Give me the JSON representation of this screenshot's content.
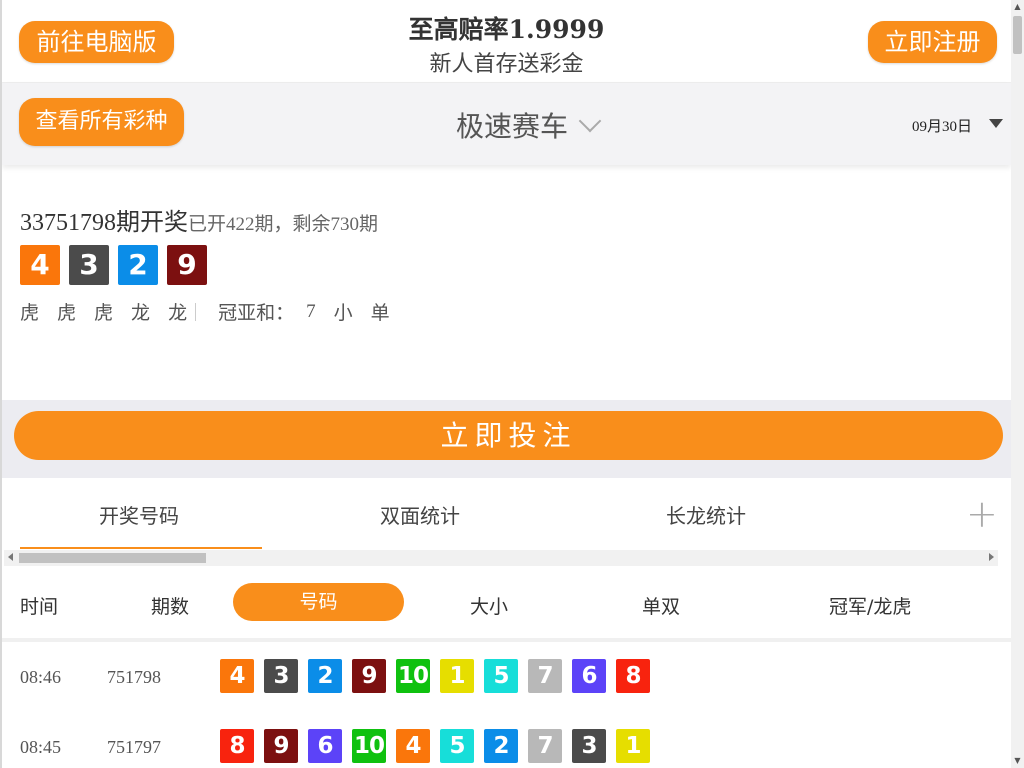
{
  "header": {
    "pc_button": "前往电脑版",
    "title": "至高赔率1.9999",
    "subtitle": "新人首存送彩金",
    "register_button": "立即注册"
  },
  "selector": {
    "all_games_button": "查看所有彩种",
    "game_name": "极速赛车",
    "date": "09月30日"
  },
  "latest": {
    "issue": "33751798期开奖",
    "progress": "已开422期，剩余730期",
    "balls": [
      4,
      3,
      2,
      9
    ],
    "dragon_tiger": [
      "虎",
      "虎",
      "虎",
      "龙",
      "龙"
    ],
    "sum_label": "冠亚和：",
    "sum_value": "7",
    "size": "小",
    "parity": "单"
  },
  "bet_button": "立即投注",
  "tabs": [
    {
      "label": "开奖号码",
      "active": true
    },
    {
      "label": "双面统计",
      "active": false
    },
    {
      "label": "长龙统计",
      "active": false
    }
  ],
  "plus_icon": "plus-icon",
  "columns": {
    "time": "时间",
    "issue": "期数",
    "numbers": "号码",
    "size": "大小",
    "parity": "单双",
    "champion": "冠军/龙虎"
  },
  "rows": [
    {
      "time": "08:46",
      "issue": "751798",
      "numbers": [
        4,
        3,
        2,
        9,
        10,
        1,
        5,
        7,
        6,
        8
      ]
    },
    {
      "time": "08:45",
      "issue": "751797",
      "numbers": [
        8,
        9,
        6,
        10,
        4,
        5,
        2,
        7,
        3,
        1
      ]
    }
  ],
  "colors": {
    "accent": "#f98e1b",
    "n1": "#e6de00",
    "n2": "#0b8de8",
    "n3": "#4b4b4b",
    "n4": "#fa760b",
    "n5": "#17ded9",
    "n6": "#5c43f8",
    "n7": "#b8b8b8",
    "n8": "#f8230e",
    "n9": "#7c1010",
    "n10": "#0fc10f"
  }
}
